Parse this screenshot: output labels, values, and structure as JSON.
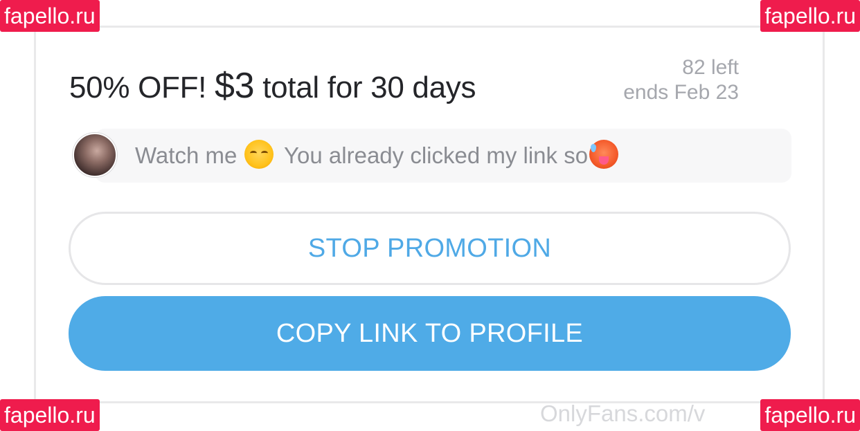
{
  "promotion": {
    "headline_prefix": "50% OFF! ",
    "price": "$3",
    "headline_suffix": " total for 30 days",
    "left_count": "82 left",
    "ends": "ends Feb 23"
  },
  "message": {
    "text_part1": "Watch me ",
    "text_part2": " You already clicked my link so",
    "emoji_1": "smiling-blushing-face",
    "emoji_2": "hot-face"
  },
  "buttons": {
    "stop_promotion": "STOP PROMOTION",
    "copy_link": "COPY LINK TO PROFILE"
  },
  "watermarks": {
    "site": "fapello.ru",
    "footer": "OnlyFans.com/v"
  },
  "colors": {
    "accent": "#4fabe7",
    "watermark": "#ef1c4d"
  }
}
